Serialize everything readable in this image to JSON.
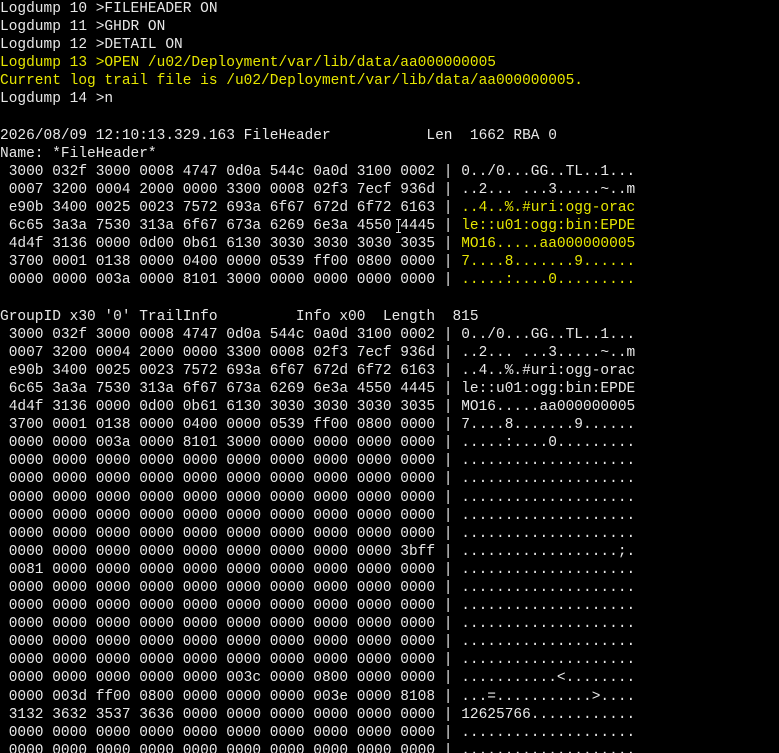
{
  "colors": {
    "background": "#000000",
    "text": "#e8e8e8",
    "highlight": "#e6e600"
  },
  "terminal": {
    "commands": [
      {
        "text": "Logdump 10 >FILEHEADER ON",
        "color": "default"
      },
      {
        "text": "Logdump 11 >GHDR ON",
        "color": "default"
      },
      {
        "text": "Logdump 12 >DETAIL ON",
        "color": "default"
      },
      {
        "text": "Logdump 13 >OPEN /u02/Deployment/var/lib/data/aa000000005",
        "color": "yellow"
      },
      {
        "text": "Current log trail file is /u02/Deployment/var/lib/data/aa000000005.",
        "color": "yellow"
      },
      {
        "text": "Logdump 14 >n",
        "color": "default"
      }
    ],
    "file_header": {
      "title_line": "2026/08/09 12:10:13.329.163 FileHeader           Len  1662 RBA 0",
      "name_line": "Name: *FileHeader*",
      "rows": [
        {
          "hex": " 3000 032f 3000 0008 4747 0d0a 544c 0a0d 3100 0002",
          "ascii": "0../0...GG..TL..1...",
          "ascii_color": "default"
        },
        {
          "hex": " 0007 3200 0004 2000 0000 3300 0008 02f3 7ecf 936d",
          "ascii": "..2... ...3.....~..m",
          "ascii_color": "default"
        },
        {
          "hex": " e90b 3400 0025 0023 7572 693a 6f67 672d 6f72 6163",
          "ascii": "..4..%.#uri:ogg-orac",
          "ascii_color": "yellow"
        },
        {
          "hex": " 6c65 3a3a 7530 313a 6f67 673a 6269 6e3a 4550 4445",
          "ascii": "le::u01:ogg:bin:EPDE",
          "ascii_color": "yellow"
        },
        {
          "hex": " 4d4f 3136 0000 0d00 0b61 6130 3030 3030 3030 3035",
          "ascii": "MO16.....aa000000005",
          "ascii_color": "yellow"
        },
        {
          "hex": " 3700 0001 0138 0000 0400 0000 0539 ff00 0800 0000",
          "ascii": "7....8.......9......",
          "ascii_color": "yellow"
        },
        {
          "hex": " 0000 0000 003a 0000 8101 3000 0000 0000 0000 0000",
          "ascii": ".....:....0.........",
          "ascii_color": "yellow"
        }
      ]
    },
    "group": {
      "title_line": "GroupID x30 '0' TrailInfo         Info x00  Length  815",
      "rows": [
        {
          "hex": " 3000 032f 3000 0008 4747 0d0a 544c 0a0d 3100 0002",
          "ascii": "0../0...GG..TL..1..."
        },
        {
          "hex": " 0007 3200 0004 2000 0000 3300 0008 02f3 7ecf 936d",
          "ascii": "..2... ...3.....~..m"
        },
        {
          "hex": " e90b 3400 0025 0023 7572 693a 6f67 672d 6f72 6163",
          "ascii": "..4..%.#uri:ogg-orac"
        },
        {
          "hex": " 6c65 3a3a 7530 313a 6f67 673a 6269 6e3a 4550 4445",
          "ascii": "le::u01:ogg:bin:EPDE"
        },
        {
          "hex": " 4d4f 3136 0000 0d00 0b61 6130 3030 3030 3030 3035",
          "ascii": "MO16.....aa000000005"
        },
        {
          "hex": " 3700 0001 0138 0000 0400 0000 0539 ff00 0800 0000",
          "ascii": "7....8.......9......"
        },
        {
          "hex": " 0000 0000 003a 0000 8101 3000 0000 0000 0000 0000",
          "ascii": ".....:....0........."
        },
        {
          "hex": " 0000 0000 0000 0000 0000 0000 0000 0000 0000 0000",
          "ascii": "...................."
        },
        {
          "hex": " 0000 0000 0000 0000 0000 0000 0000 0000 0000 0000",
          "ascii": "...................."
        },
        {
          "hex": " 0000 0000 0000 0000 0000 0000 0000 0000 0000 0000",
          "ascii": "...................."
        },
        {
          "hex": " 0000 0000 0000 0000 0000 0000 0000 0000 0000 0000",
          "ascii": "...................."
        },
        {
          "hex": " 0000 0000 0000 0000 0000 0000 0000 0000 0000 0000",
          "ascii": "...................."
        },
        {
          "hex": " 0000 0000 0000 0000 0000 0000 0000 0000 0000 3bff",
          "ascii": "..................;."
        },
        {
          "hex": " 0081 0000 0000 0000 0000 0000 0000 0000 0000 0000",
          "ascii": "...................."
        },
        {
          "hex": " 0000 0000 0000 0000 0000 0000 0000 0000 0000 0000",
          "ascii": "...................."
        },
        {
          "hex": " 0000 0000 0000 0000 0000 0000 0000 0000 0000 0000",
          "ascii": "...................."
        },
        {
          "hex": " 0000 0000 0000 0000 0000 0000 0000 0000 0000 0000",
          "ascii": "...................."
        },
        {
          "hex": " 0000 0000 0000 0000 0000 0000 0000 0000 0000 0000",
          "ascii": "...................."
        },
        {
          "hex": " 0000 0000 0000 0000 0000 0000 0000 0000 0000 0000",
          "ascii": "...................."
        },
        {
          "hex": " 0000 0000 0000 0000 0000 003c 0000 0800 0000 0000",
          "ascii": "...........<........"
        },
        {
          "hex": " 0000 003d ff00 0800 0000 0000 0000 003e 0000 8108",
          "ascii": "...=...........>...."
        },
        {
          "hex": " 3132 3632 3537 3636 0000 0000 0000 0000 0000 0000",
          "ascii": "12625766............"
        },
        {
          "hex": " 0000 0000 0000 0000 0000 0000 0000 0000 0000 0000",
          "ascii": "...................."
        },
        {
          "hex": " 0000 0000 0000 0000 0000 0000 0000 0000 0000 0000",
          "ascii": "...................."
        }
      ]
    },
    "separator": "|"
  }
}
